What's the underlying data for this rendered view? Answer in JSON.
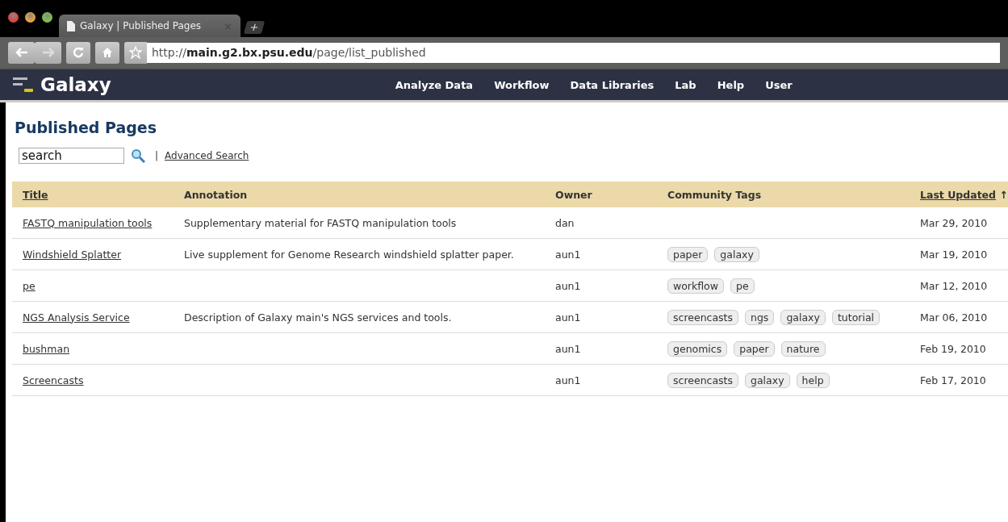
{
  "browser": {
    "tab": {
      "title": "Galaxy | Published Pages",
      "close": "×"
    },
    "new_tab": "+",
    "address": "http://**main.g2.bx.psu.edu**/page/list_published"
  },
  "masthead": {
    "brand": "Galaxy",
    "nav": [
      "Analyze Data",
      "Workflow",
      "Data Libraries",
      "Lab",
      "Help",
      "User"
    ]
  },
  "page": {
    "title": "Published Pages",
    "search": {
      "value": "search"
    },
    "separator": "|",
    "advanced_search": "Advanced Search"
  },
  "table": {
    "columns": [
      {
        "label": "Title",
        "kind": "link"
      },
      {
        "label": "Annotation",
        "kind": "plain"
      },
      {
        "label": "Owner",
        "kind": "plain"
      },
      {
        "label": "Community Tags",
        "kind": "plain"
      },
      {
        "label": "Last Updated",
        "kind": "link",
        "sort": "↑"
      }
    ],
    "rows": [
      {
        "title": "FASTQ manipulation tools",
        "annotation": "Supplementary material for FASTQ manipulation tools",
        "owner": "dan",
        "tags": [],
        "updated": "Mar 29, 2010"
      },
      {
        "title": "Windshield Splatter",
        "annotation": "Live supplement for Genome Research windshield splatter paper.",
        "owner": "aun1",
        "tags": [
          "paper",
          "galaxy"
        ],
        "updated": "Mar 19, 2010"
      },
      {
        "title": "pe",
        "owner": "aun1",
        "tags": [
          "workflow",
          "pe"
        ],
        "updated": "Mar 12, 2010"
      },
      {
        "title": "NGS Analysis Service",
        "annotation": "Description of Galaxy main's NGS services and tools.",
        "owner": "aun1",
        "tags": [
          "screencasts",
          "ngs",
          "galaxy",
          "tutorial"
        ],
        "updated": "Mar 06, 2010"
      },
      {
        "title": "bushman",
        "owner": "aun1",
        "tags": [
          "genomics",
          "paper",
          "nature"
        ],
        "updated": "Feb 19, 2010"
      },
      {
        "title": "Screencasts",
        "owner": "aun1",
        "tags": [
          "screencasts",
          "galaxy",
          "help"
        ],
        "updated": "Feb 17, 2010"
      }
    ]
  }
}
